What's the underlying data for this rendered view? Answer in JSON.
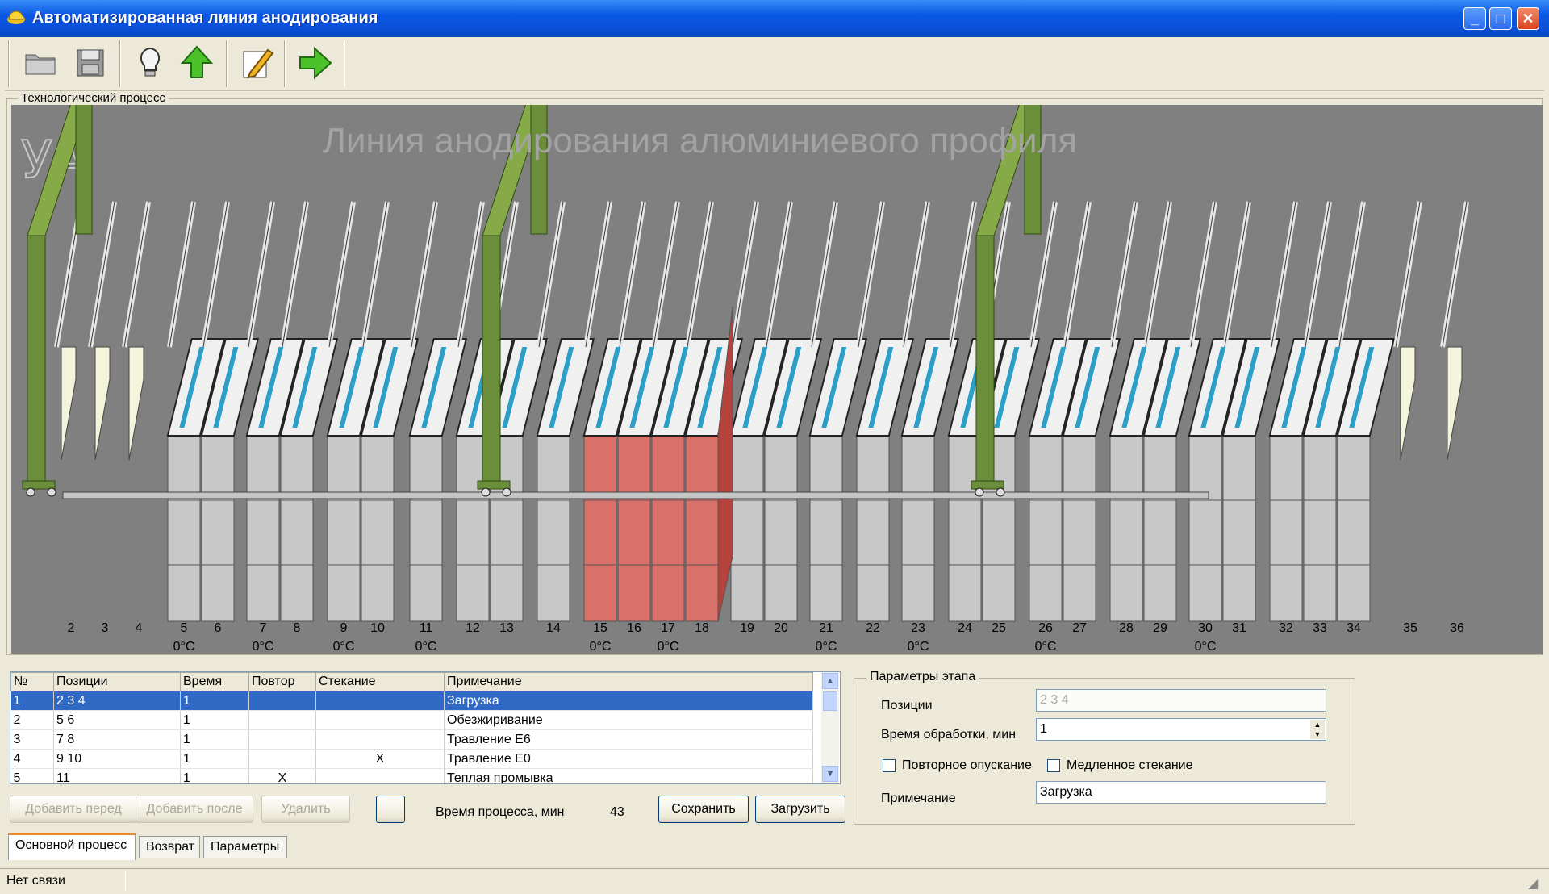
{
  "window": {
    "title": "Автоматизированная линия анодирования",
    "controls": {
      "minimize": "_",
      "maximize": "□",
      "close": "✕"
    }
  },
  "toolbar": {
    "buttons": [
      "folder-icon",
      "save-icon",
      "lightbulb-icon",
      "arrow-up-icon",
      "edit-icon",
      "arrow-right-icon"
    ]
  },
  "process_group": {
    "legend": "Технологический процесс",
    "line_title": "Линия анодирования алюминиевого профиля",
    "logo_text": "УА"
  },
  "positions": [
    "2",
    "3",
    "4",
    "5",
    "6",
    "7",
    "8",
    "9",
    "10",
    "11",
    "12",
    "13",
    "14",
    "15",
    "16",
    "17",
    "18",
    "19",
    "20",
    "21",
    "22",
    "23",
    "24",
    "25",
    "26",
    "27",
    "28",
    "29",
    "30",
    "31",
    "32",
    "33",
    "34",
    "35",
    "36"
  ],
  "temperatures": [
    {
      "pos": "5",
      "text": "0°C"
    },
    {
      "pos": "7",
      "text": "0°C"
    },
    {
      "pos": "9",
      "text": "0°C"
    },
    {
      "pos": "11",
      "text": "0°C"
    },
    {
      "pos": "15",
      "text": "0°C"
    },
    {
      "pos": "17",
      "text": "0°C"
    },
    {
      "pos": "21",
      "text": "0°C"
    },
    {
      "pos": "23",
      "text": "0°C"
    },
    {
      "pos": "26",
      "text": "0°C"
    },
    {
      "pos": "30",
      "text": "0°C"
    }
  ],
  "highlighted_positions": [
    "15",
    "16",
    "17",
    "18"
  ],
  "colors": {
    "bath": "#c8c8c8",
    "highlight": "#d9716b",
    "crane": "#6b8e3a",
    "liquid": "#2aa0c8"
  },
  "table": {
    "columns": [
      "№",
      "Позиции",
      "Время",
      "Повтор",
      "Стекание",
      "Примечание"
    ],
    "rows": [
      [
        "1",
        "2 3 4",
        "1",
        "",
        "",
        "Загрузка"
      ],
      [
        "2",
        "5 6",
        "1",
        "",
        "",
        "Обезжиривание"
      ],
      [
        "3",
        "7 8",
        "1",
        "",
        "",
        "Травление Е6"
      ],
      [
        "4",
        "9 10",
        "1",
        "",
        "X",
        "Травление Е0"
      ],
      [
        "5",
        "11",
        "1",
        "X",
        "",
        "Теплая промывка"
      ]
    ],
    "selected_row": 1
  },
  "actions": {
    "add_before": "Добавить перед",
    "add_after": "Добавить после",
    "delete": "Удалить",
    "process_time_label": "Время процесса, мин",
    "process_time_value": "43",
    "save": "Сохранить",
    "load": "Загрузить"
  },
  "params": {
    "legend": "Параметры этапа",
    "positions_label": "Позиции",
    "positions_value": "2 3 4",
    "time_label": "Время обработки, мин",
    "time_value": "1",
    "repeat_label": "Повторное опускание",
    "slow_drain_label": "Медленное стекание",
    "note_label": "Примечание",
    "note_value": "Загрузка"
  },
  "tabs": [
    "Основной процесс",
    "Возврат",
    "Параметры"
  ],
  "status": {
    "connection": "Нет связи"
  }
}
